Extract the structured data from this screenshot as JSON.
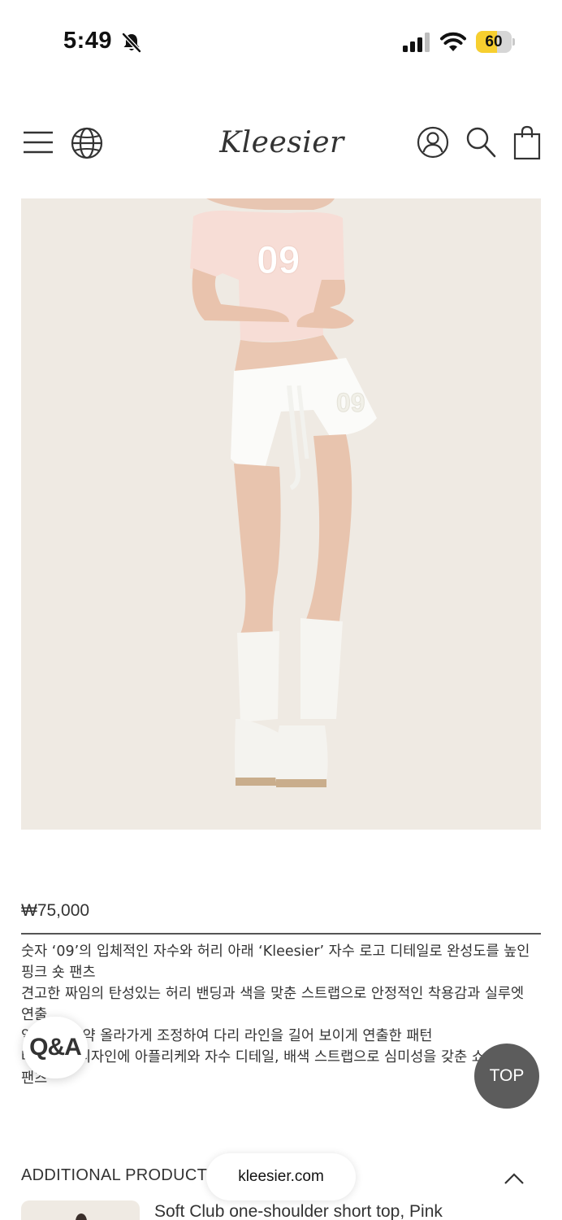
{
  "status_bar": {
    "time": "5:49",
    "battery_level": "60",
    "battery_fraction": 0.6,
    "icons": [
      "bell-slash-icon",
      "cellular-signal-icon",
      "wifi-icon",
      "battery-icon"
    ]
  },
  "header": {
    "logo": "Kleesier",
    "icons": [
      "hamburger-menu-icon",
      "globe-icon",
      "user-icon",
      "search-icon",
      "shopping-bag-icon"
    ]
  },
  "product": {
    "price": "₩75,000",
    "description": [
      "숫자 ‘09’의 입체적인 자수와 허리 아래 ‘Kleesier’ 자수 로고 디테일로 완성도를 높인",
      "핑크 숏 팬츠",
      "견고한 짜임의 탄성있는 허리 밴딩과 색을 맞춘 스트랩으로 안정적인 착용감과 실루엣",
      "연출",
      "옆 트임을 약 올라가게 조정하여 다리 라인을 길어 보이게 연출한 패턴",
      "베이직한 디자인에 아플리케와 자수 디테일, 배색 스트랩으로 심미성을 갖춘 쇼츠",
      "팬츠"
    ]
  },
  "floating": {
    "qa_label": "Q&A",
    "top_label": "TOP",
    "url": "kleesier.com"
  },
  "additional": {
    "title": "ADDITIONAL PRODUCT",
    "item_name": "Soft Club one-shoulder short top, Pink"
  },
  "colors": {
    "image_background": "#efeae3",
    "top_button": "#5c5c5c",
    "battery": "#f7cf2f"
  }
}
